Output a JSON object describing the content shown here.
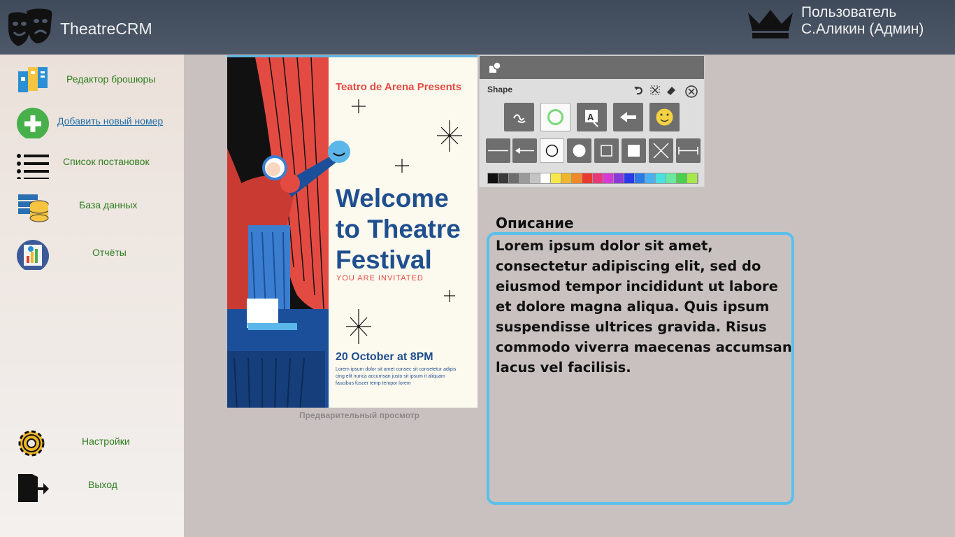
{
  "header": {
    "app_title": "TheatreCRM",
    "user_line1": "Пользователь",
    "user_line2": "С.Аликин (Админ)",
    "logo_icon": "theatre-masks-icon",
    "user_icon": "crown-icon"
  },
  "sidebar": {
    "items": [
      {
        "label": "Редактор брошюры",
        "icon": "brochure-icon"
      },
      {
        "label": "Добавить новый номер",
        "icon": "plus-circle-icon"
      },
      {
        "label": "Список постановок",
        "icon": "list-icon"
      },
      {
        "label": "База данных",
        "icon": "database-icon"
      },
      {
        "label": "Отчёты",
        "icon": "reports-icon"
      },
      {
        "label": "Настройки",
        "icon": "gear-icon"
      },
      {
        "label": "Выход",
        "icon": "exit-icon"
      }
    ]
  },
  "preview": {
    "presents": "Teatro de Arena Presents",
    "welcome": "Welcome to Theatre Festival",
    "invited": "YOU ARE INVITATED",
    "date": "20 October at 8PM",
    "lorem": "Lorem ipsum dolor sit amet consec sit consetetur adipis cing elit nunca accumsan justo sit ipsum it aliquam faucibus fuscer temp tempor lorem",
    "caption": "Предварительный просмотр"
  },
  "shape_toolbar": {
    "title": "Shape",
    "palette": [
      "#111111",
      "#3a3a3a",
      "#6e6e6e",
      "#9a9a9a",
      "#c4c4c4",
      "#ffffff",
      "#f5e94a",
      "#f0b62a",
      "#f0892a",
      "#e83a2e",
      "#e83a7a",
      "#d63ad6",
      "#8a3ad6",
      "#2a3ae8",
      "#2a7ae8",
      "#4ab0f0",
      "#4ae0e0",
      "#6ae8a0",
      "#4ad04a",
      "#a8e84a"
    ]
  },
  "description": {
    "label": "Описание",
    "text": "Lorem ipsum dolor sit amet, consectetur adipiscing elit, sed do eiusmod tempor incididunt ut labore et dolore magna aliqua. Quis ipsum suspendisse ultrices gravida. Risus commodo viverra maecenas accumsan lacus vel facilisis."
  }
}
